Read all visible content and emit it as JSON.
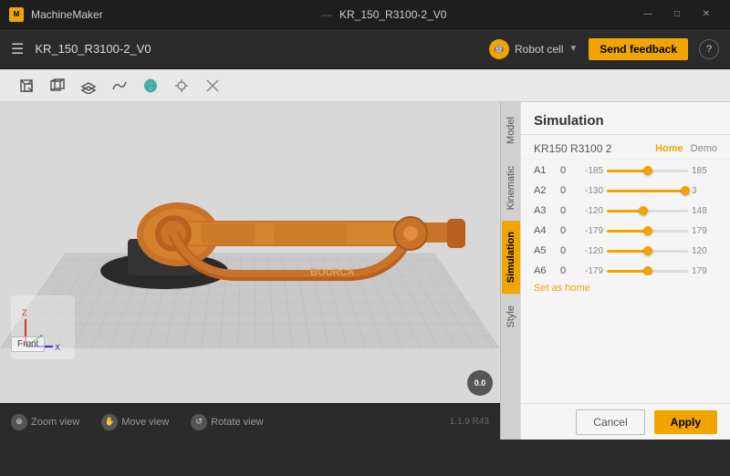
{
  "titlebar": {
    "app_name": "MachineMaker",
    "file_name": "KR_150_R3100-2_V0",
    "win_minimize": "—",
    "win_maximize": "□",
    "win_close": "✕"
  },
  "topbar": {
    "menu_icon": "☰",
    "robot_cell_label": "Robot cell",
    "feedback_label": "Send feedback",
    "help_label": "?"
  },
  "toolbar": {
    "tools": [
      {
        "name": "box-icon",
        "symbol": "⬜"
      },
      {
        "name": "box-frame-icon",
        "symbol": "◻"
      },
      {
        "name": "plane-icon",
        "symbol": "▭"
      },
      {
        "name": "path-icon",
        "symbol": "∿"
      },
      {
        "name": "sphere-icon",
        "symbol": "⬟"
      },
      {
        "name": "target-icon",
        "symbol": "◎"
      },
      {
        "name": "cross-icon",
        "symbol": "✕"
      }
    ]
  },
  "side_tabs": [
    {
      "label": "Model",
      "active": false
    },
    {
      "label": "Kinematic",
      "active": false
    },
    {
      "label": "Simulation",
      "active": true
    },
    {
      "label": "Style",
      "active": false
    }
  ],
  "panel": {
    "title": "Simulation",
    "robot_name": "KR150 R3100 2",
    "home_label": "Home",
    "demo_label": "Demo",
    "axes": [
      {
        "label": "A1",
        "value": 0,
        "min": -185,
        "max": 185,
        "percent": 50
      },
      {
        "label": "A2",
        "value": 0,
        "min": -130,
        "max": 3,
        "percent": 98
      },
      {
        "label": "A3",
        "value": 0,
        "min": -120,
        "max": 148,
        "percent": 45
      },
      {
        "label": "A4",
        "value": 0,
        "min": -179,
        "max": 179,
        "percent": 50
      },
      {
        "label": "A5",
        "value": 0,
        "min": -120,
        "max": 120,
        "percent": 50
      },
      {
        "label": "A6",
        "value": 0,
        "min": -179,
        "max": 179,
        "percent": 50
      }
    ],
    "set_home_label": "Set as home",
    "cancel_label": "Cancel",
    "apply_label": "Apply"
  },
  "view_controls": [
    {
      "label": "Zoom view",
      "icon": "🔍"
    },
    {
      "label": "Move view",
      "icon": "✋"
    },
    {
      "label": "Rotate view",
      "icon": "↺"
    }
  ],
  "version": "1.1.9 R43",
  "speed_indicator": "0.0",
  "viewport": {
    "axis_x": "X",
    "axis_y": "Y",
    "axis_z": "Z",
    "view_label": "Front"
  }
}
